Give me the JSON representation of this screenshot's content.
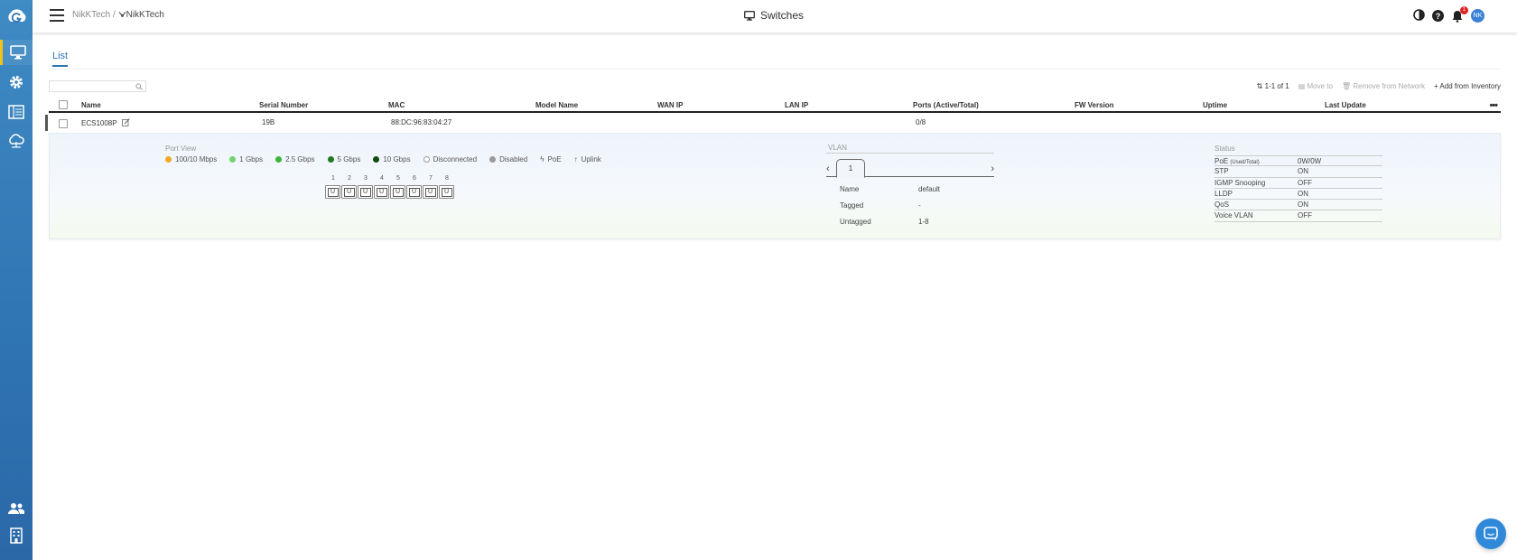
{
  "breadcrumb": {
    "org": "NikKTech",
    "separator": "/",
    "site": "NikKTech"
  },
  "header": {
    "title": "Switches",
    "notification_count": "1",
    "avatar_initials": "NK"
  },
  "tabs": {
    "list_label": "List"
  },
  "toolbar": {
    "pagination": "1-1 of 1",
    "move_to": "Move to",
    "remove_from_network": "Remove from Network",
    "add_from_inventory": "Add from Inventory"
  },
  "table": {
    "columns": [
      "Name",
      "Serial Number",
      "MAC",
      "Model Name",
      "WAN IP",
      "LAN IP",
      "Ports (Active/Total)",
      "FW Version",
      "Uptime",
      "Last Update"
    ],
    "row": {
      "name": "ECS1008P",
      "serial": "19B",
      "mac": "88:DC:96:83:04:27",
      "model": "",
      "wan_ip": "",
      "lan_ip": "",
      "ports": "0/8",
      "fw": "",
      "uptime": "",
      "last_update": ""
    }
  },
  "detail": {
    "port_view": {
      "title": "Port View",
      "legend": [
        {
          "label": "100/10 Mbps",
          "color": "#f5a623"
        },
        {
          "label": "1 Gbps",
          "color": "#6fd36f"
        },
        {
          "label": "2.5 Gbps",
          "color": "#3ab53a"
        },
        {
          "label": "5 Gbps",
          "color": "#1f7a1f"
        },
        {
          "label": "10 Gbps",
          "color": "#0f4d0f"
        },
        {
          "label": "Disconnected",
          "color": "#ffffff"
        },
        {
          "label": "Disabled",
          "color": "#999999"
        },
        {
          "label": "PoE",
          "color": ""
        },
        {
          "label": "Uplink",
          "color": ""
        }
      ],
      "port_numbers": [
        "1",
        "2",
        "3",
        "4",
        "5",
        "6",
        "7",
        "8"
      ],
      "port_labels": [
        "U",
        "U",
        "U",
        "U",
        "U",
        "U",
        "U",
        "U"
      ]
    },
    "vlan": {
      "title": "VLAN",
      "tab": "1",
      "name_label": "Name",
      "name_value": "default",
      "tagged_label": "Tagged",
      "tagged_value": "-",
      "untagged_label": "Untagged",
      "untagged_value": "1-8"
    },
    "status": {
      "title": "Status",
      "poe_label": "PoE",
      "poe_sub": "(Used/Total)",
      "poe_value": "0W/0W",
      "rows": [
        {
          "k": "STP",
          "v": "ON"
        },
        {
          "k": "IGMP Snooping",
          "v": "OFF"
        },
        {
          "k": "LLDP",
          "v": "ON"
        },
        {
          "k": "QoS",
          "v": "ON"
        },
        {
          "k": "Voice VLAN",
          "v": "OFF"
        }
      ]
    }
  }
}
